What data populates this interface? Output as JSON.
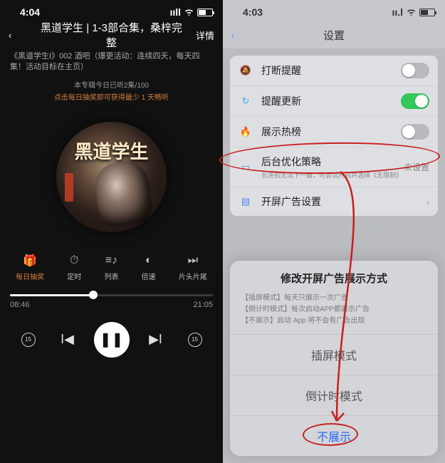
{
  "left": {
    "status": {
      "time": "4:04"
    },
    "nav": {
      "title": "黑道学生 | 1-3部合集，桑梓完整",
      "detail": "详情"
    },
    "episode_desc": "《黑道学生I》002 酒吧（爆更活动：连续四天，每天四集！活动目标在主页）",
    "album_today": "本专辑今日已听2集/100",
    "album_tip": "点击每日抽奖即可获得最少 1 天畅听",
    "album_art_title": "黑道学生",
    "controls": [
      {
        "name": "daily-draw",
        "label": "每日抽奖",
        "glyph": "🎁",
        "active": true
      },
      {
        "name": "timer",
        "label": "定时",
        "glyph": "⏱"
      },
      {
        "name": "playlist",
        "label": "列表",
        "glyph": "≡♪"
      },
      {
        "name": "speed",
        "label": "倍速",
        "glyph": "◐"
      },
      {
        "name": "skip-intro",
        "label": "片头片尾",
        "glyph": "⏭"
      }
    ],
    "progress": {
      "current": "08:46",
      "total": "21:05",
      "pct": 41
    },
    "playback": {
      "rewind": "15",
      "forward": "15"
    }
  },
  "right": {
    "status": {
      "time": "4:03"
    },
    "nav": {
      "title": "设置"
    },
    "rows": [
      {
        "name": "interrupt-remind",
        "icon": "🔕",
        "icon_color": "#5a7bd6",
        "label": "打断提醒",
        "type": "toggle",
        "on": false
      },
      {
        "name": "update-remind",
        "icon": "↻",
        "icon_color": "#3fa9f5",
        "label": "提醒更新",
        "type": "toggle",
        "on": true
      },
      {
        "name": "hot-list",
        "icon": "🔥",
        "icon_color": "#3fa9f5",
        "label": "展示热榜",
        "type": "toggle",
        "on": false
      },
      {
        "name": "bg-policy",
        "icon": "▭",
        "icon_color": "#4a87e8",
        "label": "后台优化策略",
        "sub": "长连初无法下一篇，可尝试开启并选择《无限制》",
        "type": "value",
        "value": "未设置"
      },
      {
        "name": "splash-ad",
        "icon": "▤",
        "icon_color": "#4a87e8",
        "label": "开屏广告设置",
        "type": "nav"
      }
    ],
    "sheet": {
      "title": "修改开屏广告展示方式",
      "hints": [
        "【插屏模式】每天只展示一次广告",
        "【倒计时模式】每次启动APP都展示广告",
        "【不展示】启动 App 将不会有广告出现"
      ],
      "options": [
        {
          "name": "opt-interstitial",
          "label": "插屏模式"
        },
        {
          "name": "opt-countdown",
          "label": "倒计时模式"
        },
        {
          "name": "opt-none",
          "label": "不展示",
          "primary": true
        }
      ]
    }
  }
}
